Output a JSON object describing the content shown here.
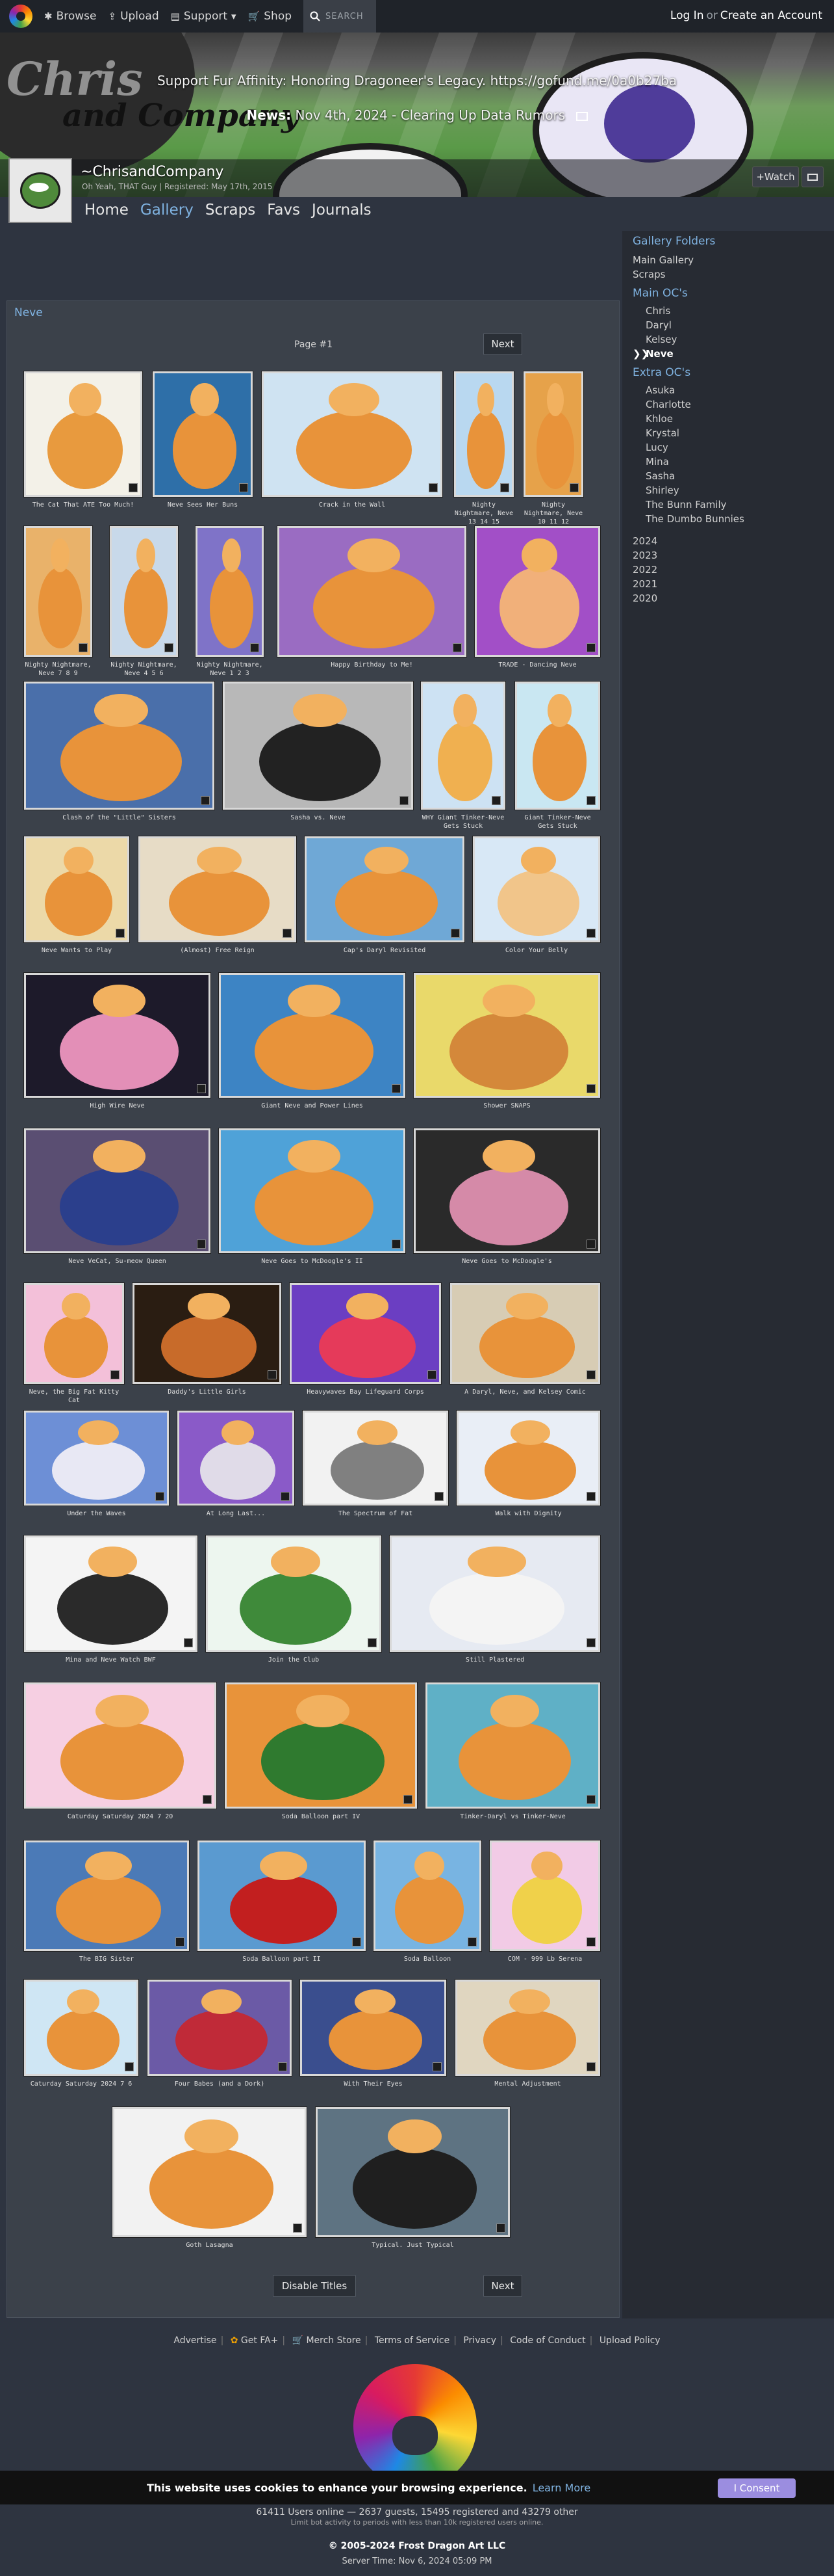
{
  "nav": {
    "browse": "Browse",
    "upload": "Upload",
    "support": "Support",
    "shop": "Shop",
    "search": "SEARCH",
    "login": "Log In",
    "or": "or",
    "create_account": "Create an Account"
  },
  "banner": {
    "support_text": "Support Fur Affinity: Honoring Dragoneer's Legacy. https://gofund.me/0a0b27ba",
    "news_label": "News:",
    "news_text": "Nov 4th, 2024 - Clearing Up Data Rumors",
    "art_text": "Chris",
    "art_text2": "and Company"
  },
  "user": {
    "name": "~ChrisandCompany",
    "subtitle": "Oh Yeah, THAT Guy | Registered: May 17th, 2015",
    "watch": "+Watch"
  },
  "tabs": [
    {
      "label": "Home"
    },
    {
      "label": "Gallery"
    },
    {
      "label": "Scraps"
    },
    {
      "label": "Favs"
    },
    {
      "label": "Journals"
    }
  ],
  "sidebar": {
    "title": "Gallery Folders",
    "top": [
      "Main Gallery",
      "Scraps"
    ],
    "main_group": "Main OC's",
    "main": [
      "Chris",
      "Daryl",
      "Kelsey"
    ],
    "selected": "Neve",
    "selected_marker": "❯❯",
    "extra_group": "Extra OC's",
    "extra": [
      "Asuka",
      "Charlotte",
      "Khloe",
      "Krystal",
      "Lucy",
      "Mina",
      "Sasha",
      "Shirley",
      "The Bunn Family",
      "The Dumbo Bunnies"
    ],
    "years": [
      "2024",
      "2023",
      "2022",
      "2021",
      "2020"
    ]
  },
  "gallery": {
    "title": "Neve",
    "page_label": "Page #1",
    "next": "Next",
    "disable_titles": "Disable Titles",
    "items": [
      {
        "title": "The Cat That ATE Too Much!"
      },
      {
        "title": "Neve Sees Her Buns"
      },
      {
        "title": "Crack in the Wall"
      },
      {
        "title": "Nighty Nightmare, Neve 13 14 15"
      },
      {
        "title": "Nighty Nightmare, Neve 10 11 12"
      },
      {
        "title": "Nighty Nightmare, Neve 7 8 9"
      },
      {
        "title": "Nighty Nightmare, Neve 4 5 6"
      },
      {
        "title": "Nighty Nightmare, Neve 1 2 3"
      },
      {
        "title": "Happy Birthday to Me!"
      },
      {
        "title": "TRADE - Dancing Neve"
      },
      {
        "title": "Clash of the \"Little\" Sisters"
      },
      {
        "title": "Sasha vs. Neve"
      },
      {
        "title": "WHY Giant Tinker-Neve Gets Stuck"
      },
      {
        "title": "Giant Tinker-Neve Gets Stuck"
      },
      {
        "title": "Neve Wants to Play"
      },
      {
        "title": "(Almost) Free Reign"
      },
      {
        "title": "Cap's Daryl Revisited"
      },
      {
        "title": "Color Your Belly"
      },
      {
        "title": "High Wire Neve"
      },
      {
        "title": "Giant Neve and Power Lines"
      },
      {
        "title": "Shower SNAPS"
      },
      {
        "title": "Neve VeCat, Su-meow Queen"
      },
      {
        "title": "Neve Goes to McDoogle's II"
      },
      {
        "title": "Neve Goes to McDoogle's"
      },
      {
        "title": "Neve, the Big Fat Kitty Cat"
      },
      {
        "title": "Daddy's Little Girls"
      },
      {
        "title": "Heavywaves Bay Lifeguard Corps"
      },
      {
        "title": "A Daryl, Neve, and Kelsey Comic"
      },
      {
        "title": "Under the Waves"
      },
      {
        "title": "At Long Last..."
      },
      {
        "title": "The Spectrum of Fat"
      },
      {
        "title": "Walk with Dignity"
      },
      {
        "title": "Mina and Neve Watch BWF"
      },
      {
        "title": "Join the Club"
      },
      {
        "title": "Still Plastered"
      },
      {
        "title": "Caturday Saturday 2024 7 20"
      },
      {
        "title": "Soda Balloon part IV"
      },
      {
        "title": "Tinker-Daryl vs Tinker-Neve"
      },
      {
        "title": "The BIG Sister"
      },
      {
        "title": "Soda Balloon part II"
      },
      {
        "title": "Soda Balloon"
      },
      {
        "title": "COM - 999 Lb Serena"
      },
      {
        "title": "Caturday Saturday 2024 7 6"
      },
      {
        "title": "Four Babes (and a Dork)"
      },
      {
        "title": "With Their Eyes"
      },
      {
        "title": "Mental Adjustment"
      },
      {
        "title": "Goth Lasagna"
      },
      {
        "title": "Typical. Just Typical"
      }
    ]
  },
  "footer": {
    "links": [
      "Advertise",
      "Get FA+",
      "Merch Store",
      "Terms of Service",
      "Privacy",
      "Code of Conduct",
      "Upload Policy"
    ],
    "cookie_text": "This website uses cookies to enhance your browsing experience.",
    "cookie_link": "Learn More",
    "cookie_button": "I Consent",
    "online_text": "61411 Users online — 2637 guests, 15495 registered and 43279 other",
    "online_sub": "Limit bot activity to periods with less than 10k registered users online.",
    "copyright": "© 2005-2024 Frost Dragon Art LLC",
    "server_time": "Server Time: Nov 6, 2024 05:09 PM"
  }
}
